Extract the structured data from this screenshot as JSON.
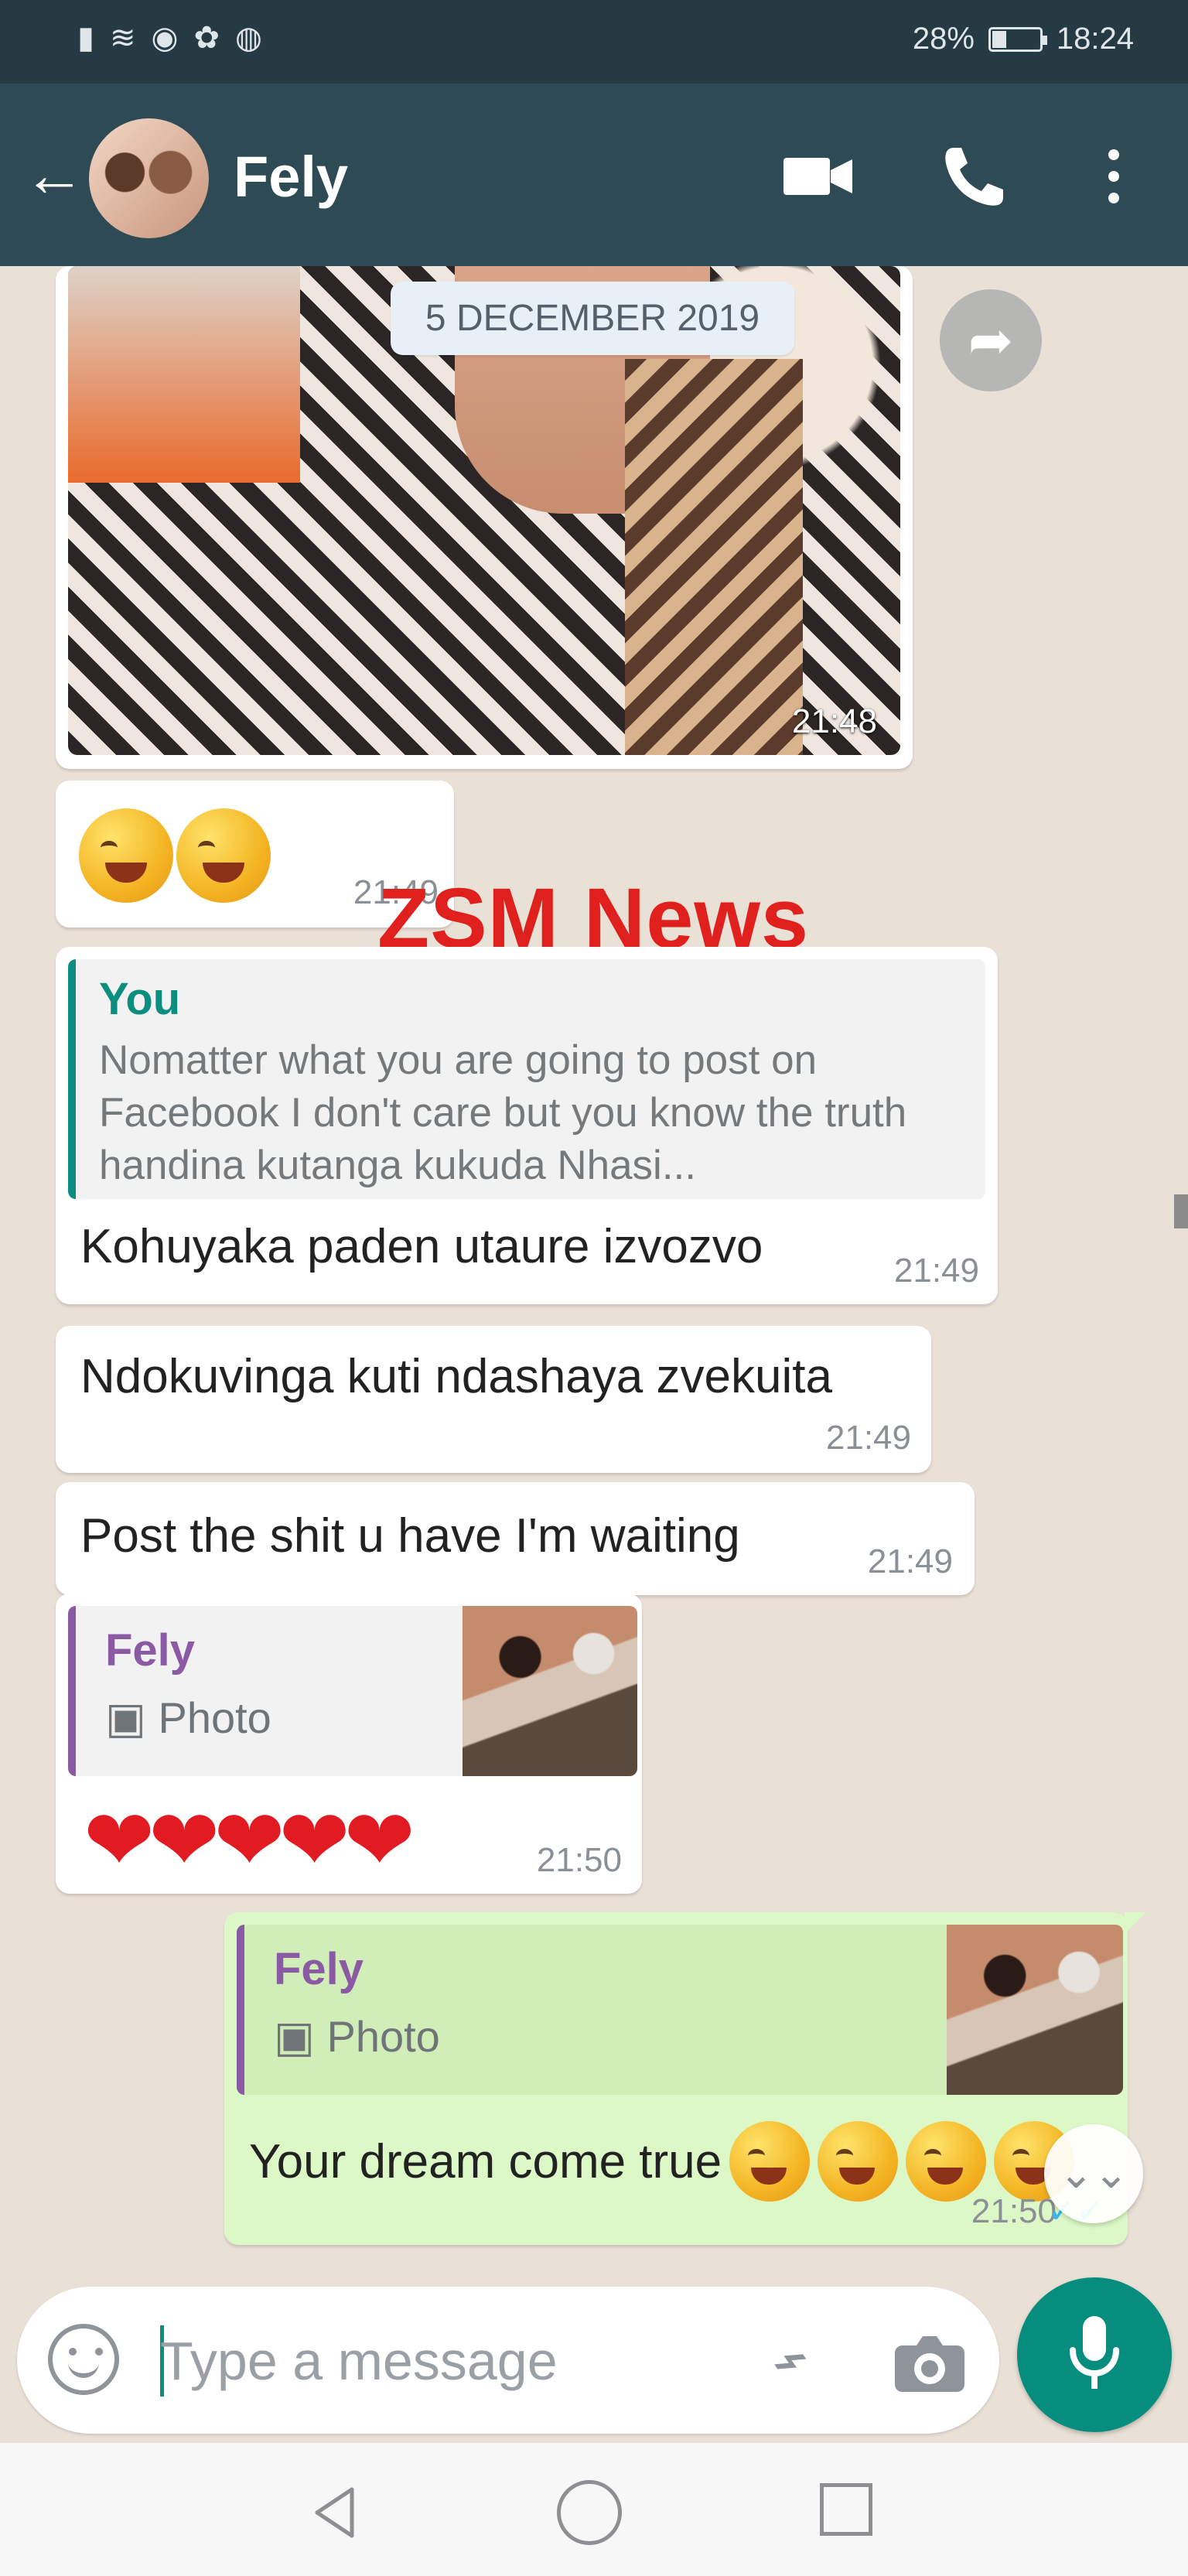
{
  "status_bar": {
    "battery": "28%",
    "time": "18:24"
  },
  "header": {
    "contact_name": "Fely"
  },
  "chat": {
    "date_label": "5 DECEMBER 2019",
    "messages": [
      {
        "id": "image",
        "time": "21:48"
      },
      {
        "id": "emoji-only",
        "time": "21:49"
      },
      {
        "id": "reply-you",
        "quote_author": "You",
        "quote_text": "Nomatter what you are going to post on Facebook I don't care but you know the truth handina kutanga kukuda Nhasi...",
        "text": "Kohuyaka paden utaure izvozvo",
        "time": "21:49"
      },
      {
        "id": "plain-1",
        "text": "Ndokuvinga kuti ndashaya zvekuita",
        "time": "21:49"
      },
      {
        "id": "plain-2",
        "text": "Post the shit u have I'm waiting",
        "time": "21:49"
      },
      {
        "id": "hearts",
        "quote_author": "Fely",
        "quote_type": "Photo",
        "text": "❤❤❤❤❤",
        "time": "21:50"
      },
      {
        "id": "outgoing",
        "quote_author": "Fely",
        "quote_type": "Photo",
        "text": "Your dream come true",
        "time": "21:50",
        "receipt": "✓✓"
      }
    ],
    "watermark": "ZSM News"
  },
  "composer": {
    "placeholder": "Type a message"
  },
  "colors": {
    "header": "#2d4a55",
    "outgoing_bubble": "#dcf8c6",
    "accent": "#078d7d",
    "watermark": "#e0201d"
  },
  "icons": [
    "signal-icon",
    "wifi-icon",
    "eye-icon",
    "gear-icon",
    "status-icon",
    "battery-icon",
    "back-arrow-icon",
    "video-call-icon",
    "phone-icon",
    "more-options-icon",
    "forward-icon",
    "emoji-icon",
    "attachment-icon",
    "camera-icon",
    "microphone-icon",
    "scroll-down-icon",
    "nav-back-icon",
    "nav-home-icon",
    "nav-recent-icon"
  ]
}
